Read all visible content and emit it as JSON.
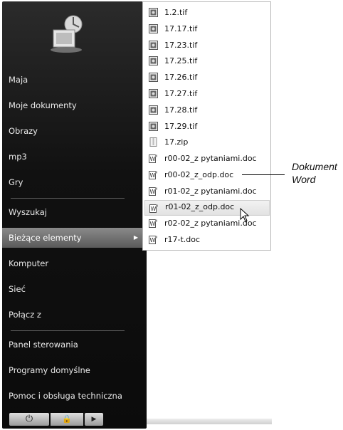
{
  "start_menu": {
    "items": [
      {
        "label": "Maja"
      },
      {
        "label": "Moje dokumenty"
      },
      {
        "label": "Obrazy"
      },
      {
        "label": "mp3"
      },
      {
        "label": "Gry"
      },
      {
        "label": "Wyszukaj"
      },
      {
        "label": "Bieżące elementy",
        "selected": true
      },
      {
        "label": "Komputer"
      },
      {
        "label": "Sieć"
      },
      {
        "label": "Połącz z"
      },
      {
        "label": "Panel sterowania"
      },
      {
        "label": "Programy domyślne"
      },
      {
        "label": "Pomoc i obsługa techniczna"
      }
    ],
    "bottom": {
      "power_icon": "power-icon",
      "lock_icon": "lock-icon",
      "more_icon": "arrow-right-icon"
    }
  },
  "recent_items": [
    {
      "name": "1.2.tif",
      "icon": "image-file-icon"
    },
    {
      "name": "17.17.tif",
      "icon": "image-file-icon"
    },
    {
      "name": "17.23.tif",
      "icon": "image-file-icon"
    },
    {
      "name": "17.25.tif",
      "icon": "image-file-icon"
    },
    {
      "name": "17.26.tif",
      "icon": "image-file-icon"
    },
    {
      "name": "17.27.tif",
      "icon": "image-file-icon"
    },
    {
      "name": "17.28.tif",
      "icon": "image-file-icon"
    },
    {
      "name": "17.29.tif",
      "icon": "image-file-icon"
    },
    {
      "name": "17.zip",
      "icon": "zip-file-icon"
    },
    {
      "name": "r00-02_z pytaniami.doc",
      "icon": "word-file-icon"
    },
    {
      "name": "r00-02_z_odp.doc",
      "icon": "word-file-icon"
    },
    {
      "name": "r01-02_z pytaniami.doc",
      "icon": "word-file-icon"
    },
    {
      "name": "r01-02_z_odp.doc",
      "icon": "word-file-icon",
      "hovered": true
    },
    {
      "name": "r02-02_z pytaniami.doc",
      "icon": "word-file-icon"
    },
    {
      "name": "r17-t.doc",
      "icon": "word-file-icon"
    }
  ],
  "annotation": {
    "line1": "Dokument",
    "line2": "Word"
  }
}
